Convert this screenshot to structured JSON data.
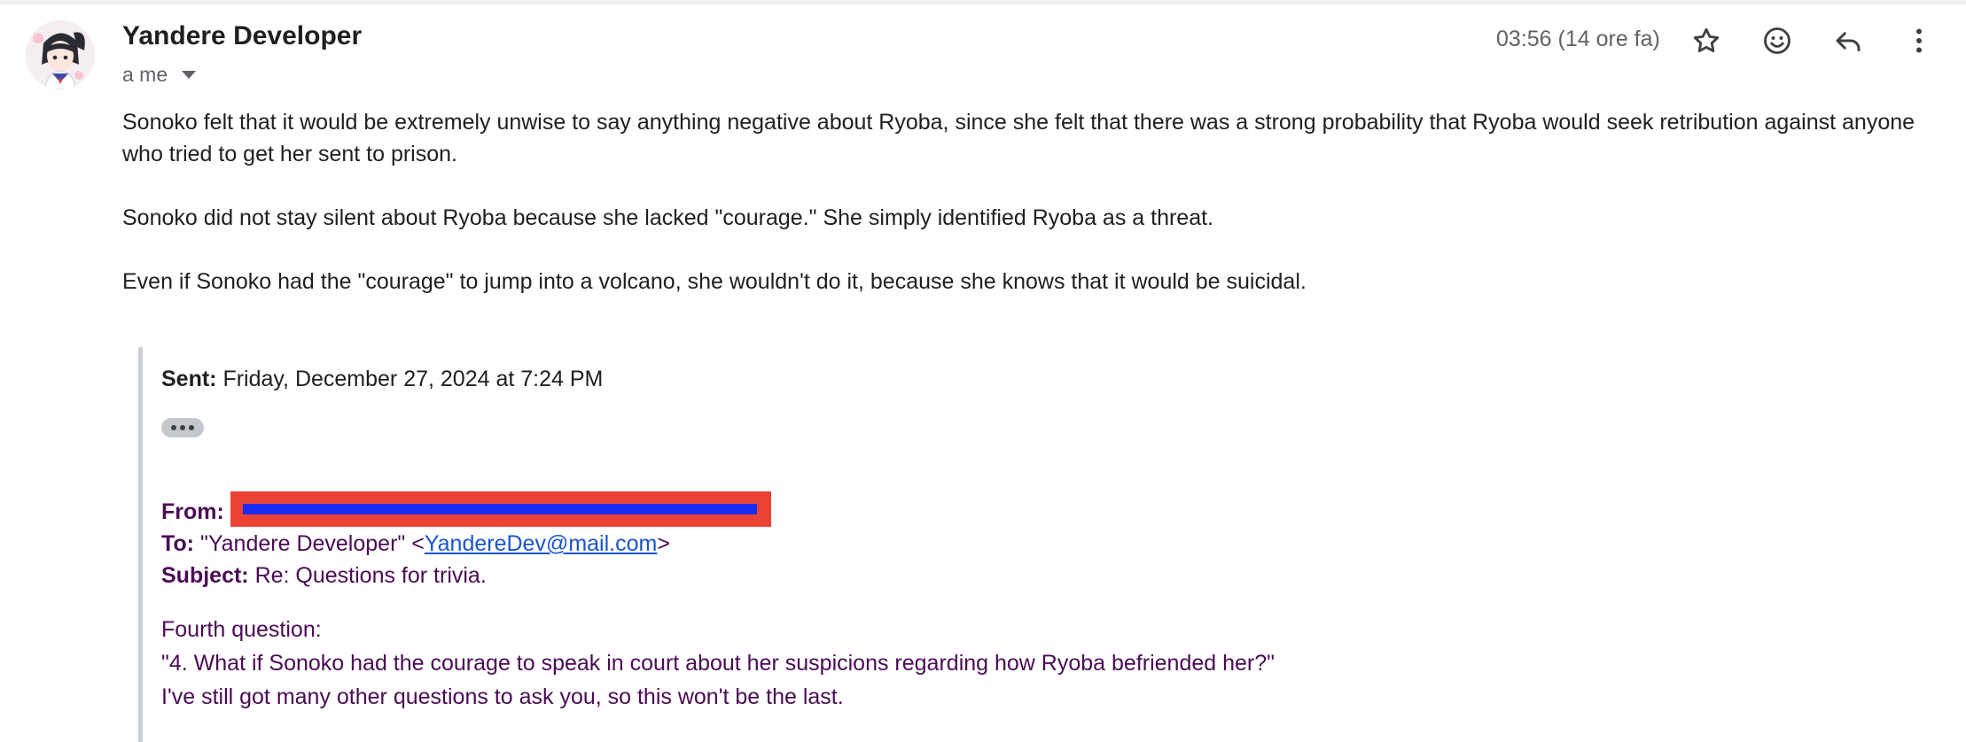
{
  "header": {
    "sender_name": "Yandere Developer",
    "recipient": "a me",
    "timestamp": "03:56 (14 ore fa)",
    "actions": [
      "star-icon",
      "emoji-icon",
      "reply-icon",
      "more-vert-icon"
    ]
  },
  "body": {
    "paragraphs": [
      "Sonoko felt that it would be extremely unwise to say anything negative about Ryoba, since she felt that there was a strong probability that Ryoba would seek retribution against anyone who tried to get her sent to prison.",
      "Sonoko did not stay silent about Ryoba because she lacked \"courage.\" She simply identified Ryoba as a threat.",
      "Even if Sonoko had the \"courage\" to jump into a volcano, she wouldn't do it, because she knows that it would be suicidal."
    ]
  },
  "quoted": {
    "sent_label": "Sent:",
    "sent_value": " Friday, December 27, 2024 at 7:24 PM",
    "from_label": "From:",
    "to_label": "To:",
    "to_name": " \"Yandere Developer\" <",
    "to_email": "YandereDev@mail.com",
    "to_close": ">",
    "subject_label": "Subject:",
    "subject_value": " Re: Questions for trivia.",
    "lines": [
      "Fourth question:",
      "\"4. What if Sonoko had the courage to speak in court about her suspicions regarding how Ryoba befriended her?\"",
      "I've still got many other questions to ask you, so this won't be the last."
    ]
  },
  "colors": {
    "quoted_text": "#4a0b54",
    "redaction_outer": "#ea4335",
    "redaction_inner": "#1a2df5",
    "link": "#1a55c9"
  }
}
